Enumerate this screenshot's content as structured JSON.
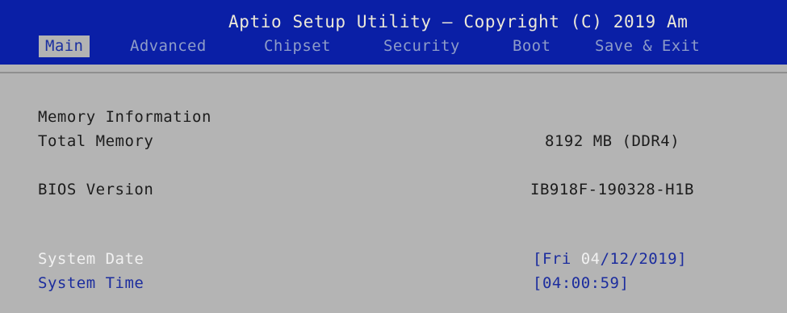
{
  "header": {
    "title": "Aptio Setup Utility – Copyright (C) 2019 Am"
  },
  "tabs": [
    {
      "label": "Main",
      "active": true
    },
    {
      "label": "Advanced",
      "active": false
    },
    {
      "label": "Chipset",
      "active": false
    },
    {
      "label": "Security",
      "active": false
    },
    {
      "label": "Boot",
      "active": false
    },
    {
      "label": "Save & Exit",
      "active": false
    }
  ],
  "main": {
    "memory_heading": "Memory Information",
    "total_memory": {
      "label": "Total Memory",
      "value": "8192 MB (DDR4)"
    },
    "bios_version": {
      "label": "BIOS Version",
      "value": "IB918F-190328-H1B"
    },
    "system_date": {
      "label": "System Date",
      "value_prefix": "[Fri ",
      "value_highlight": "04",
      "value_suffix": "/12/2019]"
    },
    "system_time": {
      "label": "System Time",
      "value": "[04:00:59]"
    }
  },
  "colors": {
    "header_bg": "#0a1fa6",
    "panel_bg": "#b4b4b4",
    "title_text": "#ece8d8",
    "inactive_tab_text": "#8e9cc8",
    "option_blue": "#1c2d9e",
    "selected_white": "#f1f1f1"
  }
}
